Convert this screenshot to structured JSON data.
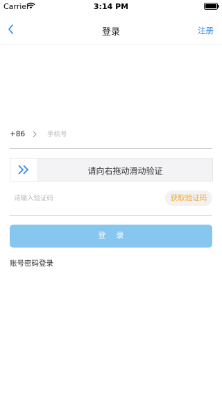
{
  "status_bar": {
    "carrier": "Carrier",
    "time": "3:14 PM"
  },
  "nav": {
    "title": "登录",
    "right_link": "注册",
    "back_icon": "chevron-left-icon"
  },
  "phone": {
    "country_code": "+86",
    "placeholder": "手机号",
    "value": ""
  },
  "slider": {
    "text": "请向右拖动滑动验证",
    "handle_icon": "double-chevron-right-icon"
  },
  "code": {
    "placeholder": "请输入验证码",
    "value": "",
    "button_label": "获取验证码"
  },
  "login_button": "登 录",
  "password_login": "账号密码登录",
  "colors": {
    "accent": "#2e86de",
    "login_button_bg": "#86c6ef",
    "get_code_text": "#f0a733"
  }
}
